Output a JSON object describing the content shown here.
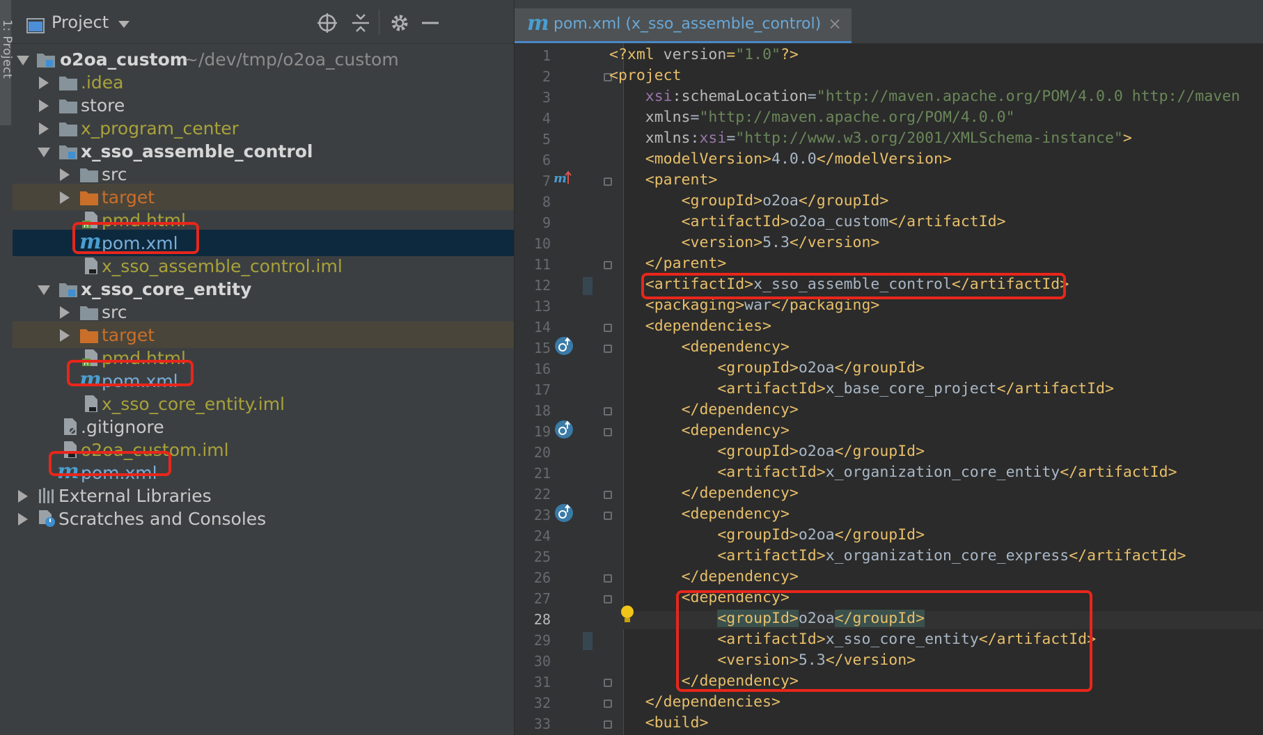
{
  "toolstrip": {
    "label": "1: Project"
  },
  "panel": {
    "title": "Project"
  },
  "tree": [
    {
      "label": "o2oa_custom",
      "path": "~/dev/tmp/o2oa_custom"
    },
    {
      "label": ".idea"
    },
    {
      "label": "store"
    },
    {
      "label": "x_program_center"
    },
    {
      "label": "x_sso_assemble_control"
    },
    {
      "label": "src"
    },
    {
      "label": "target"
    },
    {
      "label": "pmd.html"
    },
    {
      "label": "pom.xml"
    },
    {
      "label": "x_sso_assemble_control.iml"
    },
    {
      "label": "x_sso_core_entity"
    },
    {
      "label": "src"
    },
    {
      "label": "target"
    },
    {
      "label": "pmd.html"
    },
    {
      "label": "pom.xml"
    },
    {
      "label": "x_sso_core_entity.iml"
    },
    {
      "label": ".gitignore"
    },
    {
      "label": "o2oa_custom.iml"
    },
    {
      "label": "pom.xml"
    },
    {
      "label": "External Libraries"
    },
    {
      "label": "Scratches and Consoles"
    }
  ],
  "editor": {
    "tab_label": "pom.xml (x_sso_assemble_control)",
    "tab_close": "×",
    "line_numbers": [
      "1",
      "2",
      "3",
      "4",
      "5",
      "6",
      "7",
      "8",
      "9",
      "10",
      "11",
      "12",
      "13",
      "14",
      "15",
      "16",
      "17",
      "18",
      "19",
      "20",
      "21",
      "22",
      "23",
      "24",
      "25",
      "26",
      "27",
      "28",
      "29",
      "30",
      "31",
      "32",
      "33"
    ],
    "lines": [
      [
        [
          "pi",
          "<?xml "
        ],
        [
          "a",
          "version"
        ],
        [
          "pi",
          "="
        ],
        [
          "s",
          "\"1.0\""
        ],
        [
          "pi",
          "?>"
        ]
      ],
      [
        [
          "t",
          "<project"
        ]
      ],
      [
        [
          "tx",
          "    "
        ],
        [
          "ns",
          "xsi"
        ],
        [
          "a",
          ":schemaLocation"
        ],
        [
          "tx",
          "="
        ],
        [
          "s",
          "\"http://maven.apache.org/POM/4.0.0 http://maven"
        ]
      ],
      [
        [
          "tx",
          "    "
        ],
        [
          "a",
          "xmlns"
        ],
        [
          "tx",
          "="
        ],
        [
          "s",
          "\"http://maven.apache.org/POM/4.0.0\""
        ]
      ],
      [
        [
          "tx",
          "    "
        ],
        [
          "a",
          "xmlns"
        ],
        [
          "tx",
          ":"
        ],
        [
          "ns",
          "xsi"
        ],
        [
          "tx",
          "="
        ],
        [
          "s",
          "\"http://www.w3.org/2001/XMLSchema-instance\""
        ],
        [
          "t",
          ">"
        ]
      ],
      [
        [
          "tx",
          "    "
        ],
        [
          "t",
          "<modelVersion>"
        ],
        [
          "tx",
          "4.0.0"
        ],
        [
          "t",
          "</modelVersion>"
        ]
      ],
      [
        [
          "tx",
          "    "
        ],
        [
          "t",
          "<parent>"
        ]
      ],
      [
        [
          "tx",
          "        "
        ],
        [
          "t",
          "<groupId>"
        ],
        [
          "tx",
          "o2oa"
        ],
        [
          "t",
          "</groupId>"
        ]
      ],
      [
        [
          "tx",
          "        "
        ],
        [
          "t",
          "<artifactId>"
        ],
        [
          "tx",
          "o2oa_custom"
        ],
        [
          "t",
          "</artifactId>"
        ]
      ],
      [
        [
          "tx",
          "        "
        ],
        [
          "t",
          "<version>"
        ],
        [
          "tx",
          "5.3"
        ],
        [
          "t",
          "</version>"
        ]
      ],
      [
        [
          "tx",
          "    "
        ],
        [
          "t",
          "</parent>"
        ]
      ],
      [
        [
          "tx",
          "    "
        ],
        [
          "t",
          "<artifactId>"
        ],
        [
          "tx",
          "x_sso_assemble_control"
        ],
        [
          "t",
          "</artifactId>"
        ]
      ],
      [
        [
          "tx",
          "    "
        ],
        [
          "t",
          "<packaging>"
        ],
        [
          "tx",
          "war"
        ],
        [
          "t",
          "</packaging>"
        ]
      ],
      [
        [
          "tx",
          "    "
        ],
        [
          "t",
          "<dependencies>"
        ]
      ],
      [
        [
          "tx",
          "        "
        ],
        [
          "t",
          "<dependency>"
        ]
      ],
      [
        [
          "tx",
          "            "
        ],
        [
          "t",
          "<groupId>"
        ],
        [
          "tx",
          "o2oa"
        ],
        [
          "t",
          "</groupId>"
        ]
      ],
      [
        [
          "tx",
          "            "
        ],
        [
          "t",
          "<artifactId>"
        ],
        [
          "tx",
          "x_base_core_project"
        ],
        [
          "t",
          "</artifactId>"
        ]
      ],
      [
        [
          "tx",
          "        "
        ],
        [
          "t",
          "</dependency>"
        ]
      ],
      [
        [
          "tx",
          "        "
        ],
        [
          "t",
          "<dependency>"
        ]
      ],
      [
        [
          "tx",
          "            "
        ],
        [
          "t",
          "<groupId>"
        ],
        [
          "tx",
          "o2oa"
        ],
        [
          "t",
          "</groupId>"
        ]
      ],
      [
        [
          "tx",
          "            "
        ],
        [
          "t",
          "<artifactId>"
        ],
        [
          "tx",
          "x_organization_core_entity"
        ],
        [
          "t",
          "</artifactId>"
        ]
      ],
      [
        [
          "tx",
          "        "
        ],
        [
          "t",
          "</dependency>"
        ]
      ],
      [
        [
          "tx",
          "        "
        ],
        [
          "t",
          "<dependency>"
        ]
      ],
      [
        [
          "tx",
          "            "
        ],
        [
          "t",
          "<groupId>"
        ],
        [
          "tx",
          "o2oa"
        ],
        [
          "t",
          "</groupId>"
        ]
      ],
      [
        [
          "tx",
          "            "
        ],
        [
          "t",
          "<artifactId>"
        ],
        [
          "tx",
          "x_organization_core_express"
        ],
        [
          "t",
          "</artifactId>"
        ]
      ],
      [
        [
          "tx",
          "        "
        ],
        [
          "t",
          "</dependency>"
        ]
      ],
      [
        [
          "tx",
          "        "
        ],
        [
          "t",
          "<dependency>"
        ]
      ],
      [
        [
          "tx",
          "            "
        ],
        [
          "th",
          "<groupId>"
        ],
        [
          "tx",
          "o2oa"
        ],
        [
          "th",
          "</groupId>"
        ]
      ],
      [
        [
          "tx",
          "            "
        ],
        [
          "t",
          "<artifactId>"
        ],
        [
          "tx",
          "x_sso_core_entity"
        ],
        [
          "t",
          "</artifactId>"
        ]
      ],
      [
        [
          "tx",
          "            "
        ],
        [
          "t",
          "<version>"
        ],
        [
          "tx",
          "5.3"
        ],
        [
          "t",
          "</version>"
        ]
      ],
      [
        [
          "tx",
          "        "
        ],
        [
          "t",
          "</dependency>"
        ]
      ],
      [
        [
          "tx",
          "    "
        ],
        [
          "t",
          "</dependencies>"
        ]
      ],
      [
        [
          "tx",
          "    "
        ],
        [
          "t",
          "<build>"
        ]
      ]
    ]
  },
  "colors": {
    "highlight_box": "#e8261b",
    "selection": "#0d293e",
    "tag": "#e8bf6a",
    "string": "#6a8759"
  },
  "icons": [
    "project-view-icon",
    "locate-icon",
    "collapse-all-icon",
    "settings-gear-icon",
    "hide-minus-icon",
    "folder-icon",
    "module-folder-icon",
    "maven-m-icon",
    "html-file-icon",
    "iml-file-icon",
    "gitignore-file-icon",
    "libraries-icon",
    "scratches-icon",
    "override-up-icon",
    "implemented-icon",
    "lightbulb-icon"
  ]
}
